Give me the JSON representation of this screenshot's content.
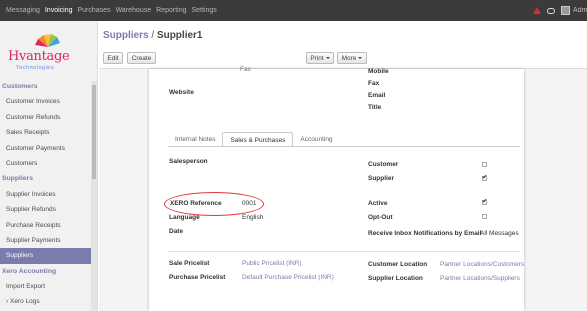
{
  "topbar": {
    "menu": [
      "Messaging",
      "Invoicing",
      "Purchases",
      "Warehouse",
      "Reporting",
      "Settings"
    ],
    "active": "Invoicing",
    "user": "Admi"
  },
  "logo": {
    "name": "Hvantage",
    "tagline": "Technologies"
  },
  "sidebar": {
    "customers_header": "Customers",
    "customers": [
      "Customer Invoices",
      "Customer Refunds",
      "Sales Receipts",
      "Customer Payments",
      "Customers"
    ],
    "suppliers_header": "Suppliers",
    "suppliers": [
      "Supplier Invoices",
      "Supplier Refunds",
      "Purchase Receipts",
      "Supplier Payments",
      "Suppliers"
    ],
    "xero_header": "Xero Accounting",
    "xero": [
      "Import Export",
      "Xero Logs"
    ]
  },
  "header": {
    "breadcrumb_parent": "Suppliers",
    "separator": "/",
    "breadcrumb_current": "Supplier1",
    "edit_label": "Edit",
    "create_label": "Create",
    "print_label": "Print",
    "more_label": "More"
  },
  "form": {
    "fax_label_left": "Fax",
    "website_label": "Website",
    "mobile_label": "Mobile",
    "fax_label": "Fax",
    "email_label": "Email",
    "title_label": "Title",
    "tabs": [
      "Internal Notes",
      "Sales & Purchases",
      "Accounting"
    ],
    "active_tab": "Sales & Purchases",
    "salesperson_label": "Salesperson",
    "customer_label": "Customer",
    "supplier_label": "Supplier",
    "xero_reference_label": "XERO Reference",
    "xero_reference_value": "0001",
    "language_label": "Language",
    "language_value": "English",
    "date_label": "Date",
    "active_label": "Active",
    "opt_out_label": "Opt-Out",
    "receive_inbox_label": "Receive Inbox Notifications by Email",
    "receive_inbox_value": "All Messages",
    "sale_pricelist_label": "Sale Pricelist",
    "sale_pricelist_value": "Public Pricelist (INR)",
    "purchase_pricelist_label": "Purchase Pricelist",
    "purchase_pricelist_value": "Default Purchase Pricelist (INR)",
    "customer_location_label": "Customer Location",
    "customer_location_value": "Partner Locations/Customers",
    "supplier_location_label": "Supplier Location",
    "supplier_location_value": "Partner Locations/Suppliers",
    "checkboxes": {
      "customer": false,
      "supplier": true,
      "active": true,
      "opt_out": false
    }
  },
  "colors": {
    "accent": "#7c7bad",
    "topbar": "#3b3b3b",
    "annotation": "#e03b3b",
    "alert": "#e02a2a"
  }
}
